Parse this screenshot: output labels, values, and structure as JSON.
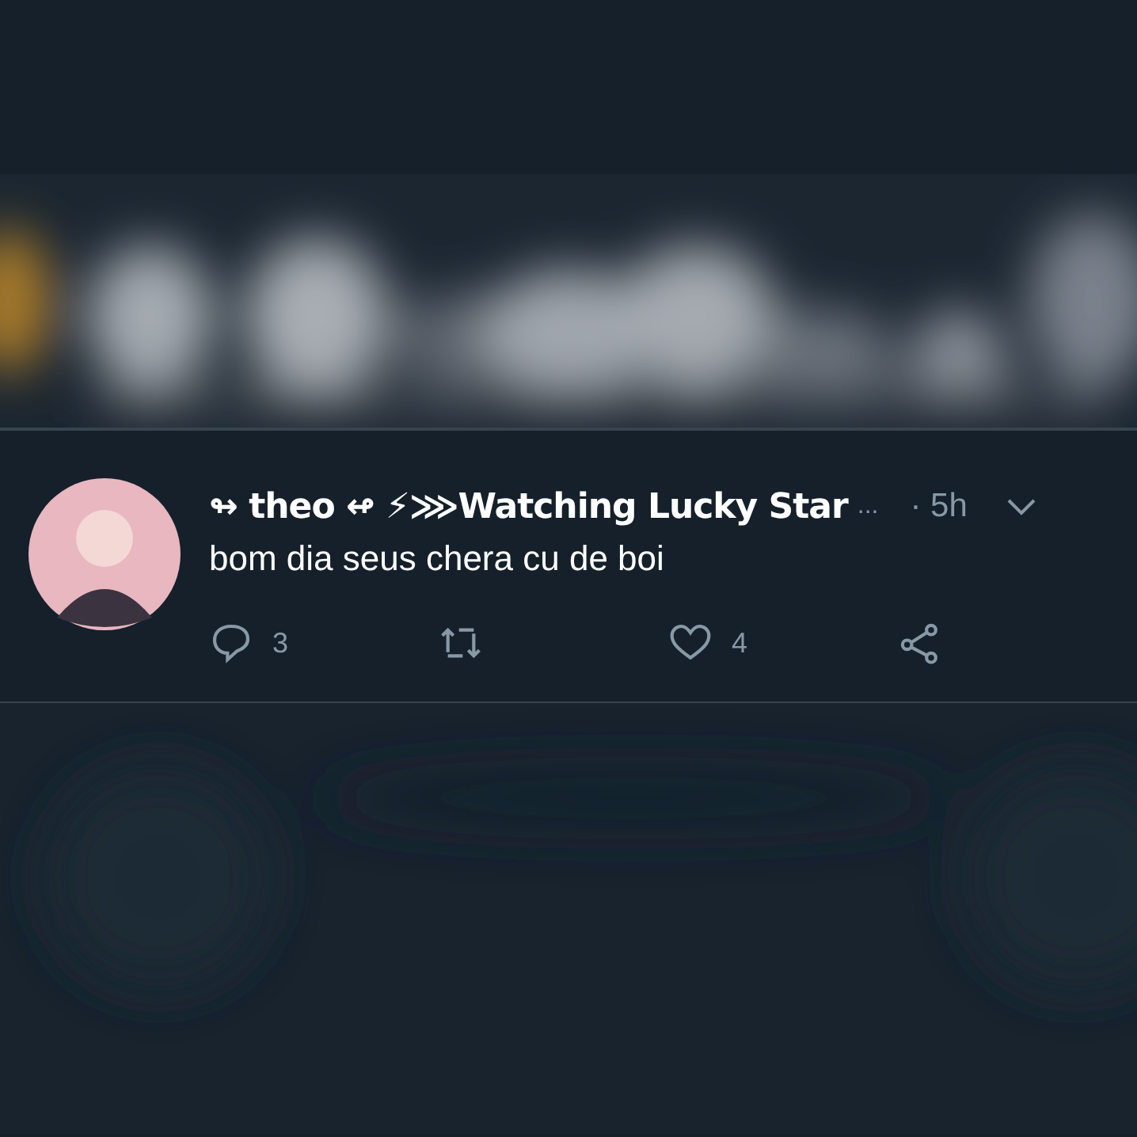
{
  "tweet": {
    "display_name": "↬ theo ↫ ⚡⋙Watching Lucky Star",
    "ellipsis": "...",
    "time": "· 5h",
    "text": "bom dia seus chera cu de boi",
    "actions": [
      {
        "kind": "reply",
        "count": "3"
      },
      {
        "kind": "retweet"
      },
      {
        "kind": "like",
        "count": "4"
      },
      {
        "kind": "share"
      }
    ]
  }
}
